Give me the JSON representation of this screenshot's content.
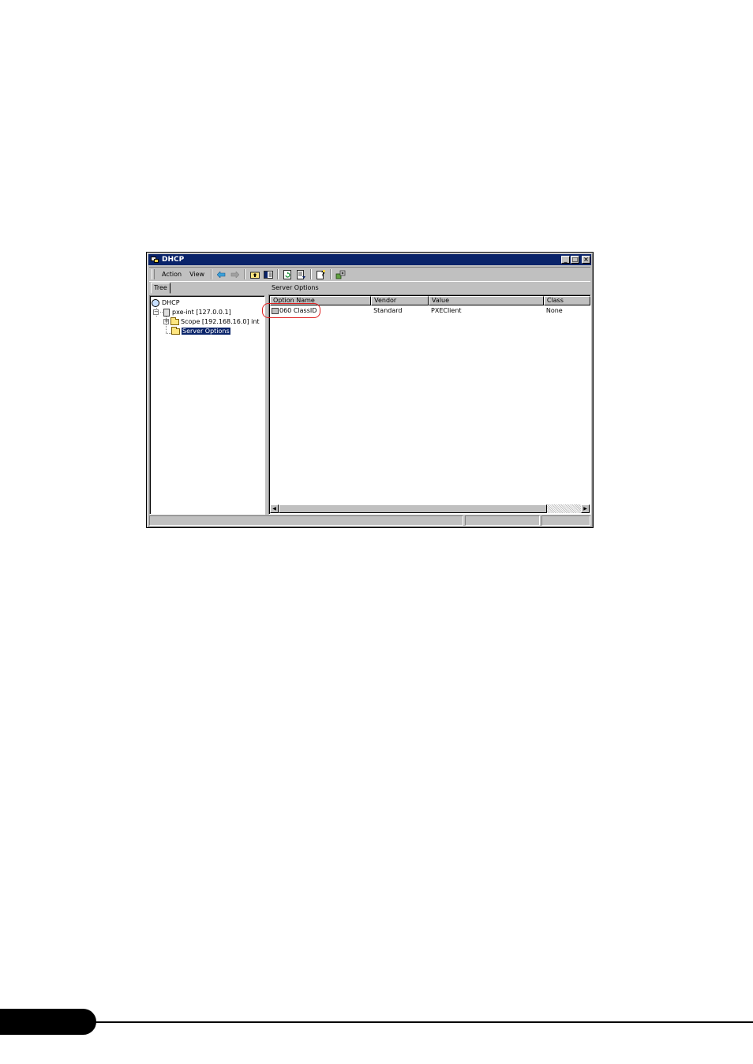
{
  "window": {
    "title": "DHCP",
    "controls": [
      "minimize",
      "maximize",
      "close"
    ]
  },
  "menu": {
    "action_label": "Action",
    "view_label": "View"
  },
  "toolbar_icons": [
    "back-arrow-icon",
    "forward-arrow-icon",
    "up-folder-icon",
    "show-tree-icon",
    "refresh-icon",
    "export-list-icon",
    "help-icon",
    "server-options-icon"
  ],
  "tree": {
    "tab_label": "Tree",
    "root": "DHCP",
    "server": "pxe-int [127.0.0.1]",
    "scope": "Scope [192.168.16.0] int",
    "server_options": "Server Options"
  },
  "detail": {
    "header": "Server Options",
    "columns": [
      "Option Name",
      "Vendor",
      "Value",
      "Class"
    ],
    "rows": [
      {
        "option_name": "060 ClassID",
        "vendor": "Standard",
        "value": "PXEClient",
        "class": "None"
      }
    ]
  },
  "colors": {
    "title_bar": "#0a246a",
    "highlight_ring": "#e02020",
    "window_face": "#c0c0c0"
  }
}
